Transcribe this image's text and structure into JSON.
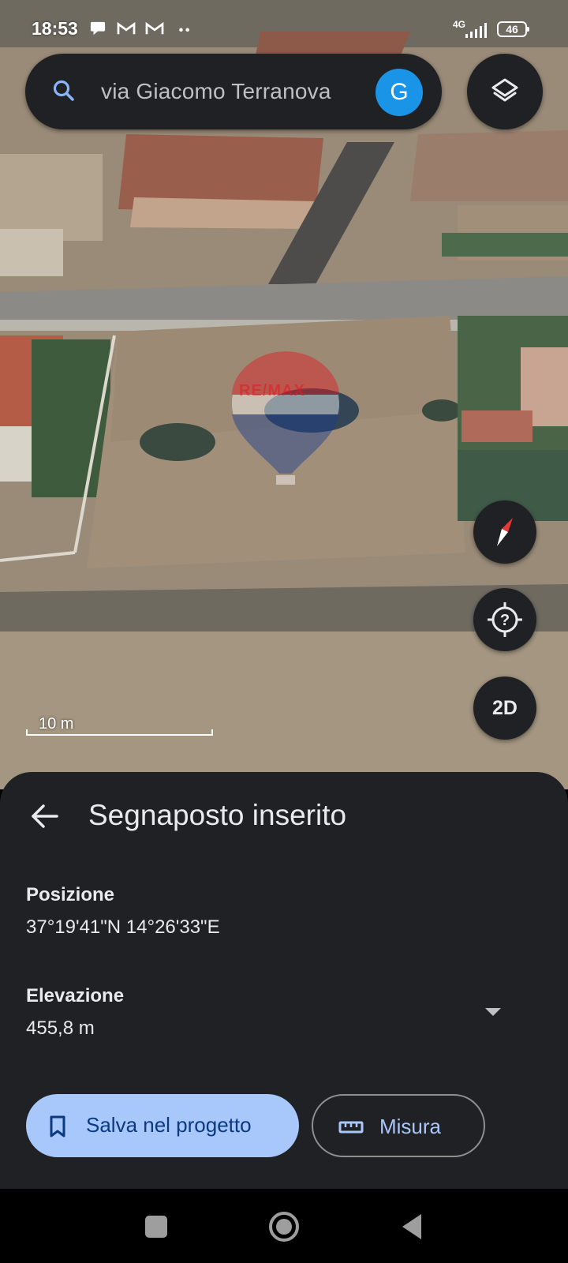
{
  "status_bar": {
    "time": "18:53",
    "network": "4G",
    "battery": "46"
  },
  "search": {
    "query": "via Giacomo Terranova",
    "account_initial": "G"
  },
  "map": {
    "watermark": "RE/MAX",
    "scale_label": "10 m",
    "view_mode_label": "2D"
  },
  "sheet": {
    "title": "Segnaposto inserito",
    "position_label": "Posizione",
    "position_value": "37°19'41\"N 14°26'33\"E",
    "elevation_label": "Elevazione",
    "elevation_value": "455,8 m",
    "save_button": "Salva nel progetto",
    "measure_button": "Misura"
  },
  "colors": {
    "sheet_bg": "#202124",
    "primary_button": "#a8c7fa",
    "account_badge": "#1a94e6",
    "compass_needle": "#e53935"
  }
}
